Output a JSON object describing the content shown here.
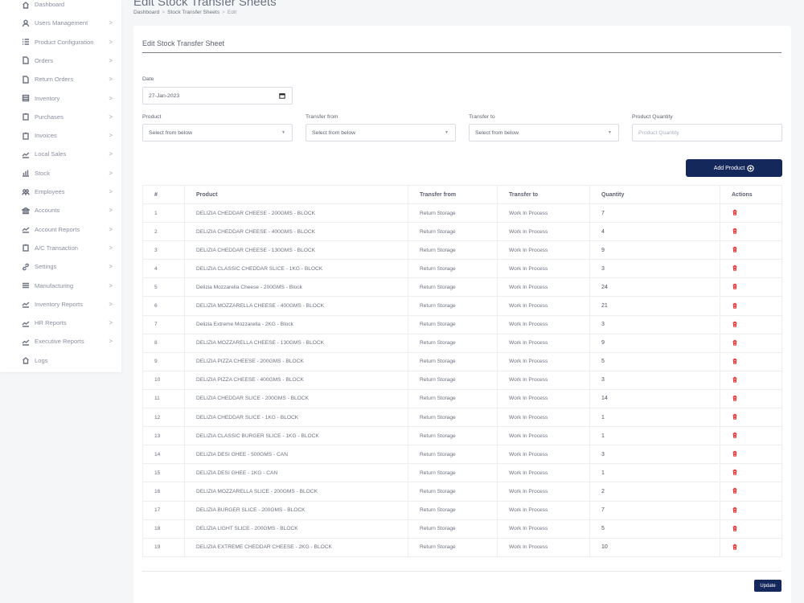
{
  "sidebar": {
    "items": [
      {
        "label": "Dashboard",
        "icon": "home-icon",
        "chevron": false
      },
      {
        "label": "Users Management",
        "icon": "user-icon",
        "chevron": true
      },
      {
        "label": "Product Configuration",
        "icon": "list-icon",
        "chevron": true
      },
      {
        "label": "Orders",
        "icon": "file-icon",
        "chevron": true
      },
      {
        "label": "Return Orders",
        "icon": "file-icon",
        "chevron": true
      },
      {
        "label": "Inventory",
        "icon": "box-icon",
        "chevron": true
      },
      {
        "label": "Purchases",
        "icon": "clipboard-icon",
        "chevron": true
      },
      {
        "label": "Invoices",
        "icon": "clipboard-icon",
        "chevron": true
      },
      {
        "label": "Local Sales",
        "icon": "trend-icon",
        "chevron": true
      },
      {
        "label": "Stock",
        "icon": "chart-icon",
        "chevron": true
      },
      {
        "label": "Employees",
        "icon": "users-icon",
        "chevron": true
      },
      {
        "label": "Accounts",
        "icon": "bank-icon",
        "chevron": true
      },
      {
        "label": "Account Reports",
        "icon": "trend-icon",
        "chevron": true
      },
      {
        "label": "A/C Transaction",
        "icon": "clipboard-icon",
        "chevron": true
      },
      {
        "label": "Settings",
        "icon": "link-icon",
        "chevron": true
      },
      {
        "label": "Manufacturing",
        "icon": "menu-icon",
        "chevron": true
      },
      {
        "label": "Inventory Reports",
        "icon": "trend-icon",
        "chevron": true
      },
      {
        "label": "HR Reports",
        "icon": "trend-icon",
        "chevron": true
      },
      {
        "label": "Executive Reports",
        "icon": "trend-icon",
        "chevron": true
      },
      {
        "label": "Logs",
        "icon": "home-icon",
        "chevron": false
      }
    ],
    "chevron_glyph": ">"
  },
  "header": {
    "title": "Edit Stock Transfer Sheets",
    "breadcrumb": [
      "Dashboard",
      "Stock Transfer Sheets",
      "Edit"
    ],
    "breadcrumb_sep": ">"
  },
  "form": {
    "card_title": "Edit Stock Transfer Sheet",
    "date_label": "Date",
    "date_value": "27-Jan-2023",
    "product_label": "Product",
    "product_value": "Select from below",
    "from_label": "Transfer from",
    "from_value": "Select from below",
    "to_label": "Transfer to",
    "to_value": "Select from below",
    "qty_label": "Product Quantity",
    "qty_placeholder": "Product Quantity",
    "add_button": "Add Product",
    "update_button": "Update"
  },
  "table": {
    "headers": [
      "#",
      "Product",
      "Transfer from",
      "Transfer to",
      "Quantity",
      "Actions"
    ],
    "rows": [
      [
        "1",
        "DELIZIA CHEDDAR CHEESE - 200GMS - BLOCK",
        "Return Storage",
        "Work In Process",
        "7"
      ],
      [
        "2",
        "DELIZIA CHEDDAR CHEESE - 400GMS - BLOCK",
        "Return Storage",
        "Work In Process",
        "4"
      ],
      [
        "3",
        "DELIZIA CHEDDAR CHEESE - 130GMS - BLOCK",
        "Return Storage",
        "Work In Process",
        "9"
      ],
      [
        "4",
        "DELIZIA CLASSIC CHEDDAR SLICE - 1KG - BLOCK",
        "Return Storage",
        "Work In Process",
        "3"
      ],
      [
        "5",
        "Delizia Mozzarella Cheese - 200GMS - Block",
        "Return Storage",
        "Work In Process",
        "24"
      ],
      [
        "6",
        "DELIZIA MOZZARELLA CHEESE - 400GMS - BLOCK",
        "Return Storage",
        "Work In Process",
        "21"
      ],
      [
        "7",
        "Delizia Extreme Mozzarella - 2KG - Block",
        "Return Storage",
        "Work In Process",
        "3"
      ],
      [
        "8",
        "DELIZIA MOZZARELLA CHEESE - 130GMS - BLOCK",
        "Return Storage",
        "Work In Process",
        "9"
      ],
      [
        "9",
        "DELIZIA PIZZA CHEESE - 200GMS - BLOCK",
        "Return Storage",
        "Work In Process",
        "5"
      ],
      [
        "10",
        "DELIZIA PIZZA CHEESE - 400GMS - BLOCK",
        "Return Storage",
        "Work In Process",
        "3"
      ],
      [
        "11",
        "DELIZIA CHEDDAR SLICE - 200GMS - BLOCK",
        "Return Storage",
        "Work In Process",
        "14"
      ],
      [
        "12",
        "DELIZIA CHEDDAR SLICE - 1KG - BLOCK",
        "Return Storage",
        "Work In Process",
        "1"
      ],
      [
        "13",
        "DELIZIA CLASSIC BURGER SLICE - 1KG - BLOCK",
        "Return Storage",
        "Work In Process",
        "1"
      ],
      [
        "14",
        "DELIZIA DESI GHEE - 500GMS - CAN",
        "Return Storage",
        "Work In Process",
        "3"
      ],
      [
        "15",
        "DELIZIA DESI GHEE - 1KG - CAN",
        "Return Storage",
        "Work In Process",
        "1"
      ],
      [
        "16",
        "DELIZIA MOZZARELLA SLICE - 200GMS - BLOCK",
        "Return Storage",
        "Work In Process",
        "2"
      ],
      [
        "17",
        "DELIZIA BURGER SLICE - 200GMS - BLOCK",
        "Return Storage",
        "Work In Process",
        "7"
      ],
      [
        "18",
        "DELIZIA LIGHT SLICE - 200GMS - BLOCK",
        "Return Storage",
        "Work In Process",
        "5"
      ],
      [
        "19",
        "DELIZIA EXTREME CHEDDAR CHEESE - 2KG - BLOCK",
        "Return Storage",
        "Work In Process",
        "10"
      ]
    ],
    "delete_icon": "trash-icon"
  },
  "colors": {
    "primary": "#14285c",
    "danger": "#e53e3e",
    "background": "#f5f6f8"
  }
}
